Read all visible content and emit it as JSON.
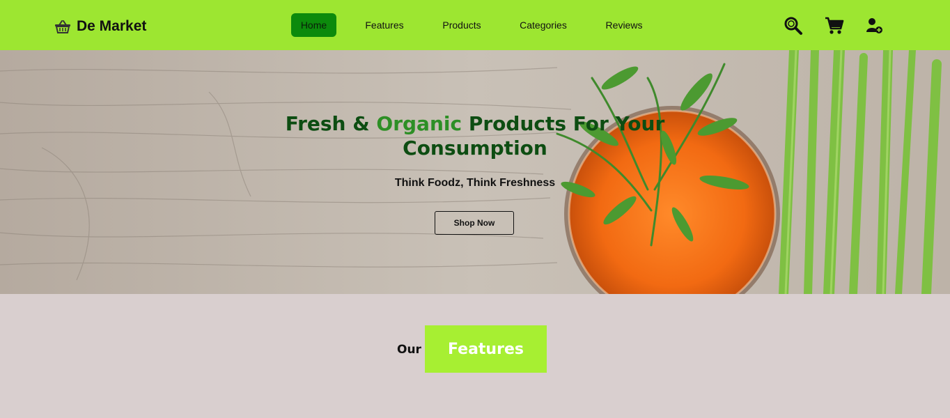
{
  "brand": {
    "name": "De Market",
    "icon": "basket-icon"
  },
  "nav": {
    "items": [
      {
        "label": "Home",
        "active": true
      },
      {
        "label": "Features",
        "active": false
      },
      {
        "label": "Products",
        "active": false
      },
      {
        "label": "Categories",
        "active": false
      },
      {
        "label": "Reviews",
        "active": false
      }
    ]
  },
  "header_icons": [
    "search-icon",
    "cart-icon",
    "user-add-icon"
  ],
  "hero": {
    "title_part1": "Fresh & ",
    "title_highlight": "Organic",
    "title_part2": " Products For Your Consumption",
    "subtitle": "Think Foodz, Think Freshness",
    "button_label": "Shop Now"
  },
  "features_section": {
    "prefix": "Our",
    "title": "Features"
  },
  "colors": {
    "header_bg": "#9de631",
    "nav_active_bg": "#0c8a0c",
    "title_green": "#0d4d12",
    "highlight_green": "#2d8f25",
    "section_bg": "#d9cfcf",
    "features_box_bg": "#a7ef32"
  }
}
